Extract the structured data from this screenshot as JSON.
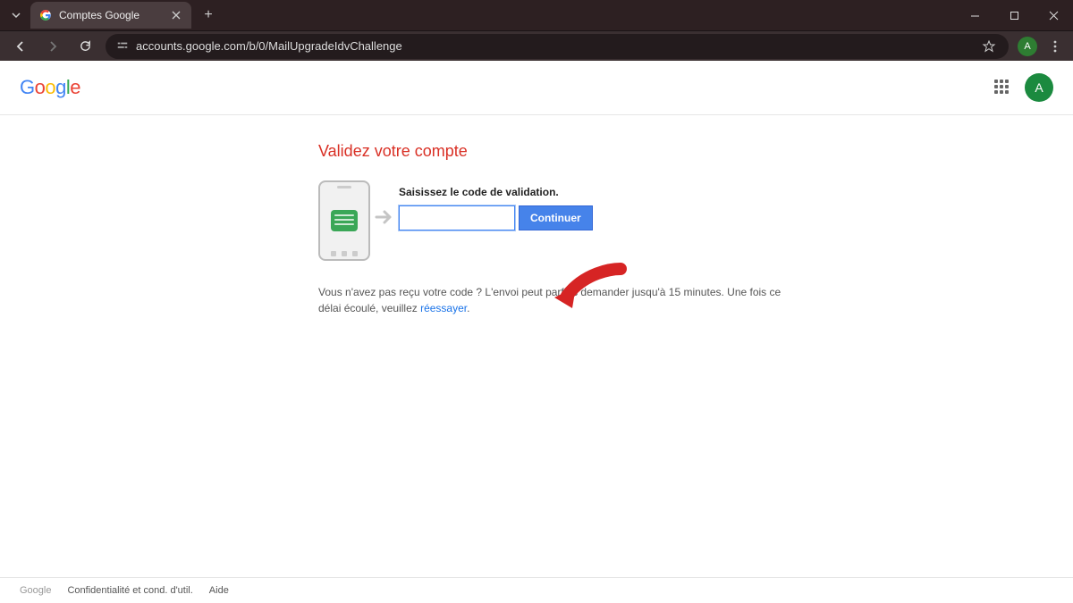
{
  "browser": {
    "tab_title": "Comptes Google",
    "url": "accounts.google.com/b/0/MailUpgradeIdvChallenge",
    "profile_letter": "A"
  },
  "header": {
    "logo_text": "Google",
    "avatar_letter": "A"
  },
  "main": {
    "heading": "Validez votre compte",
    "input_label": "Saisissez le code de validation.",
    "input_value": "",
    "continue_label": "Continuer",
    "help_prefix": "Vous n'avez pas reçu votre code ? L'envoi peut parfois demander jusqu'à 15 minutes. Une fois ce délai écoulé, veuillez ",
    "help_link": "réessayer",
    "help_suffix": "."
  },
  "footer": {
    "link1": "Google",
    "link2": "Confidentialité et cond. d'util.",
    "link3": "Aide"
  }
}
